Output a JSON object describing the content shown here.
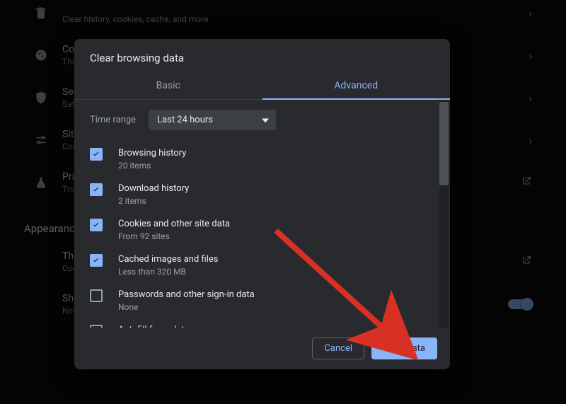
{
  "bg": {
    "rows": [
      {
        "title": "…",
        "sub": "Clear history, cookies, cache, and more",
        "icon": "trash"
      },
      {
        "title": "Cook…",
        "sub": "Third…",
        "icon": "cookie"
      },
      {
        "title": "Secu…",
        "sub": "Safe…",
        "icon": "shield"
      },
      {
        "title": "Site S…",
        "sub": "Cont…",
        "icon": "sliders"
      },
      {
        "title": "Priva…",
        "sub": "Trial…",
        "icon": "flask"
      }
    ],
    "section_appearance": "Appearance",
    "theme_t": "Theme",
    "theme_s": "Open Chro…",
    "home_t": "Show home…",
    "home_s": "New Tab pa…",
    "url_value": "https://phoenixnap.com/kb/wp-admin/"
  },
  "dialog": {
    "title": "Clear browsing data",
    "tab_basic": "Basic",
    "tab_advanced": "Advanced",
    "time_range_label": "Time range",
    "time_range_value": "Last 24 hours",
    "options": [
      {
        "checked": true,
        "t1": "Browsing history",
        "t2": "20 items"
      },
      {
        "checked": true,
        "t1": "Download history",
        "t2": "2 items"
      },
      {
        "checked": true,
        "t1": "Cookies and other site data",
        "t2": "From 92 sites"
      },
      {
        "checked": true,
        "t1": "Cached images and files",
        "t2": "Less than 320 MB"
      },
      {
        "checked": false,
        "t1": "Passwords and other sign-in data",
        "t2": "None"
      },
      {
        "checked": false,
        "t1": "Autofill form data",
        "t2": ""
      }
    ],
    "cancel": "Cancel",
    "clear": "Clear data"
  }
}
